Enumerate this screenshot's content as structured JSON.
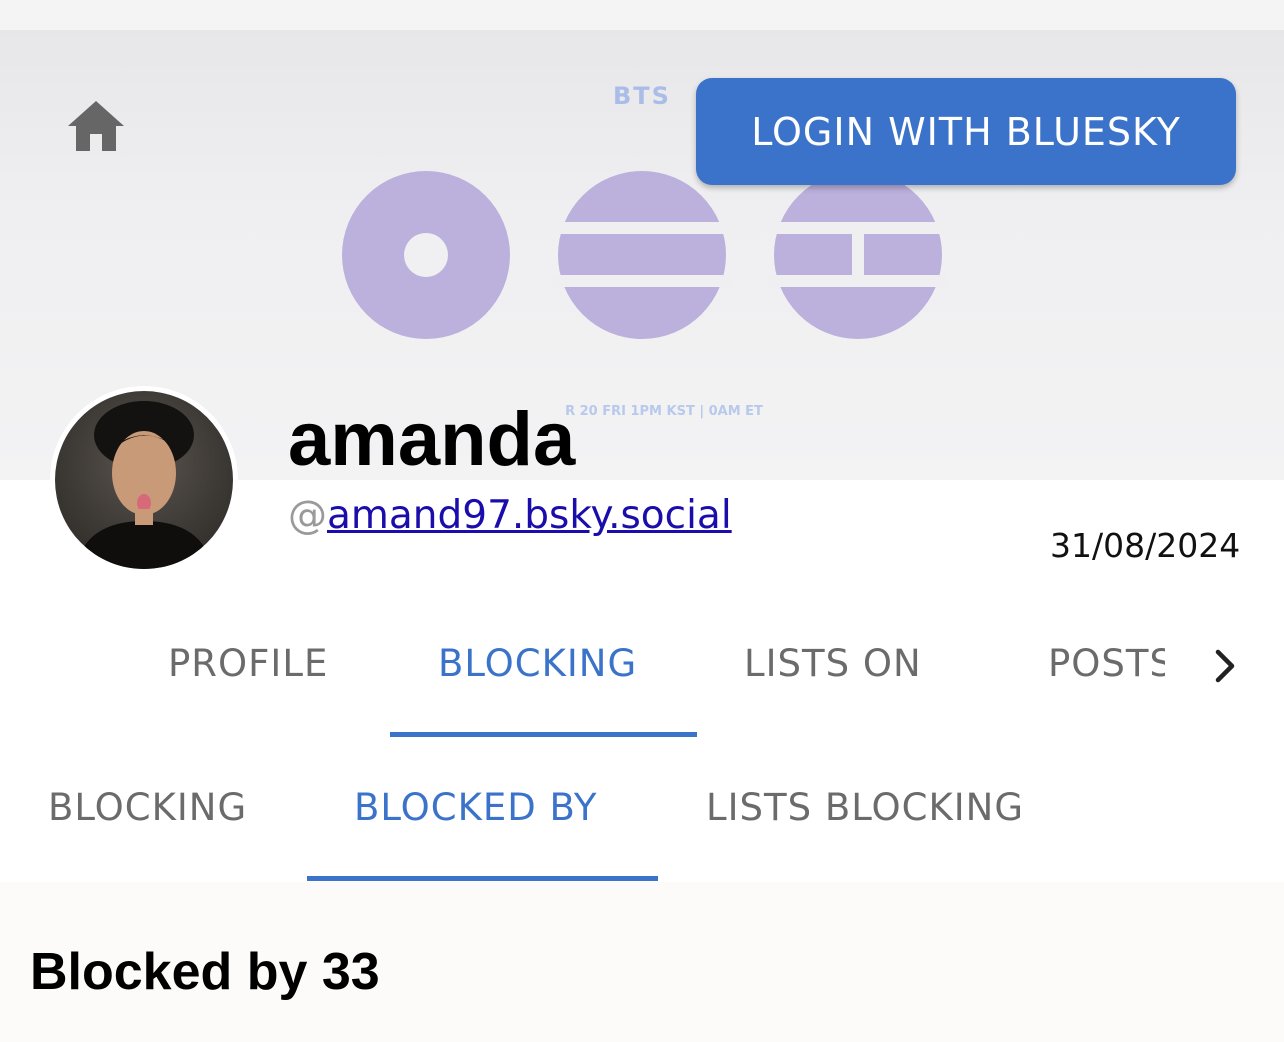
{
  "header": {
    "home_icon": "home-icon",
    "login_label": "LOGIN WITH BLUESKY",
    "accent_color": "#3a73c9"
  },
  "banner": {
    "brand_text": "BTS",
    "caption": "R 20 FRI 1PM KST | 0AM ET",
    "shape_color": "#bcb0dc"
  },
  "profile": {
    "display_name": "amanda",
    "handle_prefix": "@",
    "handle": "amand97.bsky.social",
    "date": "31/08/2024"
  },
  "main_tabs": {
    "items": [
      {
        "label": "PROFILE",
        "active": false
      },
      {
        "label": "BLOCKING",
        "active": true
      },
      {
        "label": "LISTS ON",
        "active": false
      },
      {
        "label": "POSTS",
        "active": false
      }
    ],
    "scroll_icon": "chevron-right-icon"
  },
  "sub_tabs": {
    "items": [
      {
        "label": "BLOCKING",
        "active": false
      },
      {
        "label": "BLOCKED BY",
        "active": true
      },
      {
        "label": "LISTS BLOCKING",
        "active": false
      }
    ]
  },
  "content": {
    "heading": "Blocked by 33"
  }
}
